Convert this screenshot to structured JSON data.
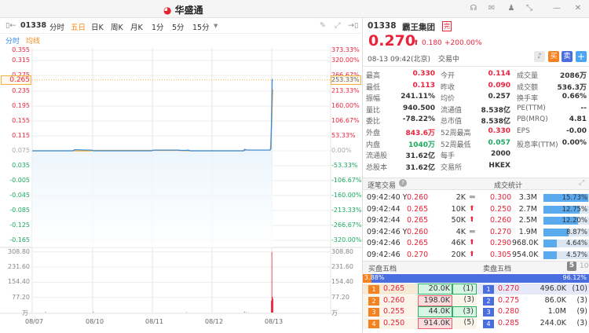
{
  "app": {
    "title": "华盛通",
    "header_icons": [
      "headset-icon",
      "mail-icon",
      "shirt-icon",
      "pin-icon",
      "minimize-icon",
      "close-icon"
    ]
  },
  "toolbar": {
    "code": "01338",
    "tabs": [
      "分时",
      "五日",
      "日K",
      "周K",
      "月K",
      "1分",
      "5分",
      "15分"
    ],
    "active": "五日"
  },
  "legend": {
    "line": "分时",
    "avg": "均线"
  },
  "chart": {
    "price_ticks": [
      "0.355",
      "0.315",
      "0.275",
      "0.235",
      "0.195",
      "0.155",
      "0.115",
      "0.075",
      "0.035",
      "-0.005",
      "-0.045",
      "-0.085",
      "-0.125",
      "-0.165"
    ],
    "pct_ticks": [
      "373.33%",
      "320.00%",
      "266.67%",
      "213.33%",
      "160.00%",
      "106.67%",
      "53.33%",
      "0.00%",
      "-53.33%",
      "-106.67%",
      "-160.00%",
      "-213.33%",
      "-266.67%",
      "-320.00%"
    ],
    "cursor_price": "0.265",
    "cursor_pct": "253.33%",
    "vol_ticks": [
      "308.80",
      "231.60",
      "154.40",
      "77.20"
    ],
    "vol_unit": "万",
    "dates": [
      "08/07",
      "08/10",
      "08/11",
      "08/12",
      "08/13"
    ],
    "colors": {
      "line": "#2e8ae6",
      "avg": "#f0a020",
      "up": "#e8243c",
      "down": "#1aa860"
    }
  },
  "chart_data": {
    "type": "line",
    "title": "01338 五日分时",
    "x_unit": "slot (100 per day)",
    "ylim": [
      -0.185,
      0.365
    ],
    "prev_close": 0.075,
    "series": [
      {
        "name": "分时",
        "points": [
          [
            0,
            0.075
          ],
          [
            68,
            0.075
          ],
          [
            71,
            0.078
          ],
          [
            90,
            0.077
          ],
          [
            100,
            0.077
          ],
          [
            103,
            0.075
          ],
          [
            200,
            0.075
          ],
          [
            203,
            0.077
          ],
          [
            245,
            0.077
          ],
          [
            250,
            0.076
          ],
          [
            258,
            0.076
          ],
          [
            261,
            0.077
          ],
          [
            265,
            0.075
          ],
          [
            354,
            0.075
          ],
          [
            356,
            0.079
          ],
          [
            360,
            0.077
          ],
          [
            398,
            0.077
          ],
          [
            400,
            0.08
          ],
          [
            401,
            0.17
          ],
          [
            402,
            0.265
          ],
          [
            403,
            0.262
          ]
        ]
      },
      {
        "name": "均线",
        "points": [
          [
            0,
            0.075
          ],
          [
            100,
            0.075
          ],
          [
            103,
            0.076
          ],
          [
            200,
            0.076
          ],
          [
            245,
            0.076
          ],
          [
            265,
            0.075
          ],
          [
            354,
            0.075
          ],
          [
            358,
            0.077
          ],
          [
            399,
            0.077
          ],
          [
            401,
            0.14
          ],
          [
            403,
            0.24
          ]
        ]
      }
    ],
    "volume": {
      "name": "成交量(万)",
      "bars": [
        [
          22,
          4,
          "up"
        ],
        [
          102,
          3,
          "up"
        ],
        [
          101,
          2,
          "down"
        ],
        [
          258,
          2,
          "up"
        ],
        [
          355,
          5,
          "up"
        ],
        [
          358,
          3,
          "down"
        ],
        [
          362,
          2,
          "down"
        ],
        [
          400,
          60,
          "up"
        ],
        [
          401,
          308.8,
          "up"
        ],
        [
          402,
          80,
          "up"
        ],
        [
          403,
          70,
          "up"
        ]
      ]
    }
  },
  "quote": {
    "code": "01338",
    "name": "霸王集团",
    "badge": "完",
    "price": "0.270",
    "change": "0.180",
    "change_pct": "+200.00%",
    "time": "08-13  09:42(北京)",
    "status": "交易中",
    "buy": "买",
    "sell": "卖",
    "add": "+"
  },
  "stats": [
    [
      "最高",
      "0.330",
      "今开",
      "0.114",
      "成交量",
      "2086万"
    ],
    [
      "最低",
      "0.113",
      "昨收",
      "0.090",
      "成交额",
      "536.3万"
    ],
    [
      "振幅",
      "241.11%",
      "均价",
      "0.257",
      "换手率",
      "0.66%"
    ],
    [
      "量比",
      "940.500",
      "流通值",
      "8.538亿",
      "PE(TTM)",
      "--"
    ],
    [
      "委比",
      "-78.22%",
      "总市值",
      "8.538亿",
      "PB(MRQ)",
      "4.81"
    ],
    [
      "外盘",
      "843.6万",
      "52周最高",
      "0.330",
      "EPS",
      "-0.00"
    ],
    [
      "内盘",
      "1040万",
      "52周最低",
      "0.057",
      "股息率(TTM)",
      "0.00%"
    ],
    [
      "流通股",
      "31.62亿",
      "每手",
      "2000",
      "",
      ""
    ],
    [
      "总股本",
      "31.62亿",
      "交易所",
      "HKEX",
      "",
      ""
    ]
  ],
  "trades_title": "逐笔交易",
  "stats_title": "成交统计",
  "trades": [
    [
      "09:42:40 Y",
      "0.260",
      "2K",
      "flat"
    ],
    [
      "09:42:44",
      "0.265",
      "10K",
      "up"
    ],
    [
      "09:42:44",
      "0.265",
      "50K",
      "up"
    ],
    [
      "09:42:46 Y",
      "0.260",
      "4K",
      "flat"
    ],
    [
      "09:42:46",
      "0.265",
      "46K",
      "up"
    ],
    [
      "09:42:46",
      "0.270",
      "20K",
      "up"
    ]
  ],
  "vol_stats": [
    [
      "0.300",
      "3.3M",
      "15.73%",
      15.73
    ],
    [
      "0.250",
      "2.7M",
      "12.75%",
      12.75
    ],
    [
      "0.260",
      "2.5M",
      "12.20%",
      12.2
    ],
    [
      "0.270",
      "1.9M",
      "8.87%",
      8.87
    ],
    [
      "0.290",
      "968.0K",
      "4.64%",
      4.64
    ],
    [
      "0.305",
      "954.0K",
      "4.57%",
      4.57
    ]
  ],
  "book": {
    "bid_title": "买盘五档",
    "ask_title": "卖盘五档",
    "levels5": "5",
    "levels10": "10",
    "bid_pct": "3.88%",
    "ask_pct": "96.12%",
    "bids": [
      [
        "1",
        "0.265",
        "20.0K",
        "(1)"
      ],
      [
        "2",
        "0.260",
        "198.0K",
        "(3)"
      ],
      [
        "3",
        "0.255",
        "44.0K",
        "(3)"
      ],
      [
        "4",
        "0.250",
        "914.0K",
        "(5)"
      ]
    ],
    "asks": [
      [
        "1",
        "0.270",
        "496.0K",
        "(10)"
      ],
      [
        "2",
        "0.275",
        "86.0K",
        "(3)"
      ],
      [
        "3",
        "0.280",
        "1.0M",
        "(9)"
      ],
      [
        "4",
        "0.285",
        "244.0K",
        "(3)"
      ]
    ]
  }
}
